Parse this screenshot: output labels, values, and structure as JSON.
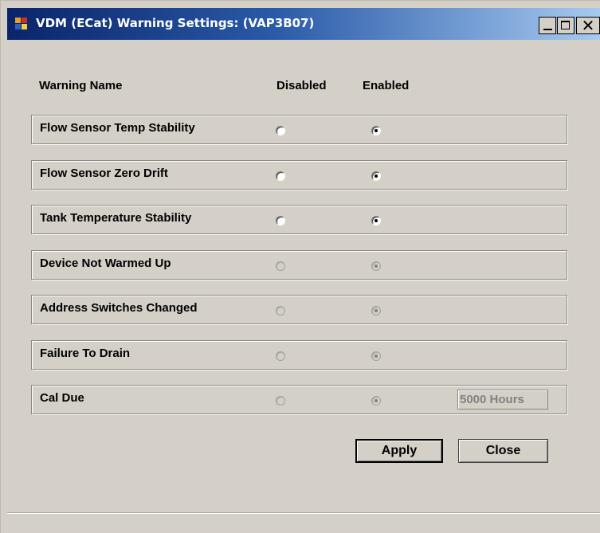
{
  "window": {
    "title": "VDM (ECat) Warning Settings: (VAP3B07)"
  },
  "headers": {
    "warning_name": "Warning Name",
    "disabled": "Disabled",
    "enabled": "Enabled"
  },
  "warnings": [
    {
      "name": "Flow Sensor Temp Stability",
      "selected": "enabled",
      "editable": true
    },
    {
      "name": "Flow Sensor Zero Drift",
      "selected": "enabled",
      "editable": true
    },
    {
      "name": "Tank Temperature Stability",
      "selected": "enabled",
      "editable": true
    },
    {
      "name": "Device Not Warmed Up",
      "selected": "enabled",
      "editable": false
    },
    {
      "name": "Address Switches Changed",
      "selected": "enabled",
      "editable": false
    },
    {
      "name": "Failure To Drain",
      "selected": "enabled",
      "editable": false
    },
    {
      "name": "Cal Due",
      "selected": "enabled",
      "editable": false
    }
  ],
  "cal_due_hours": "5000 Hours",
  "buttons": {
    "apply": "Apply",
    "close": "Close"
  },
  "colors": {
    "title_bar_start": "#0a246a",
    "title_bar_end": "#a6caf0",
    "window_face": "#d4d0c8"
  },
  "icons": {
    "app": "app-window-icon",
    "minimize": "minimize-icon",
    "maximize": "maximize-icon",
    "close": "close-icon"
  }
}
